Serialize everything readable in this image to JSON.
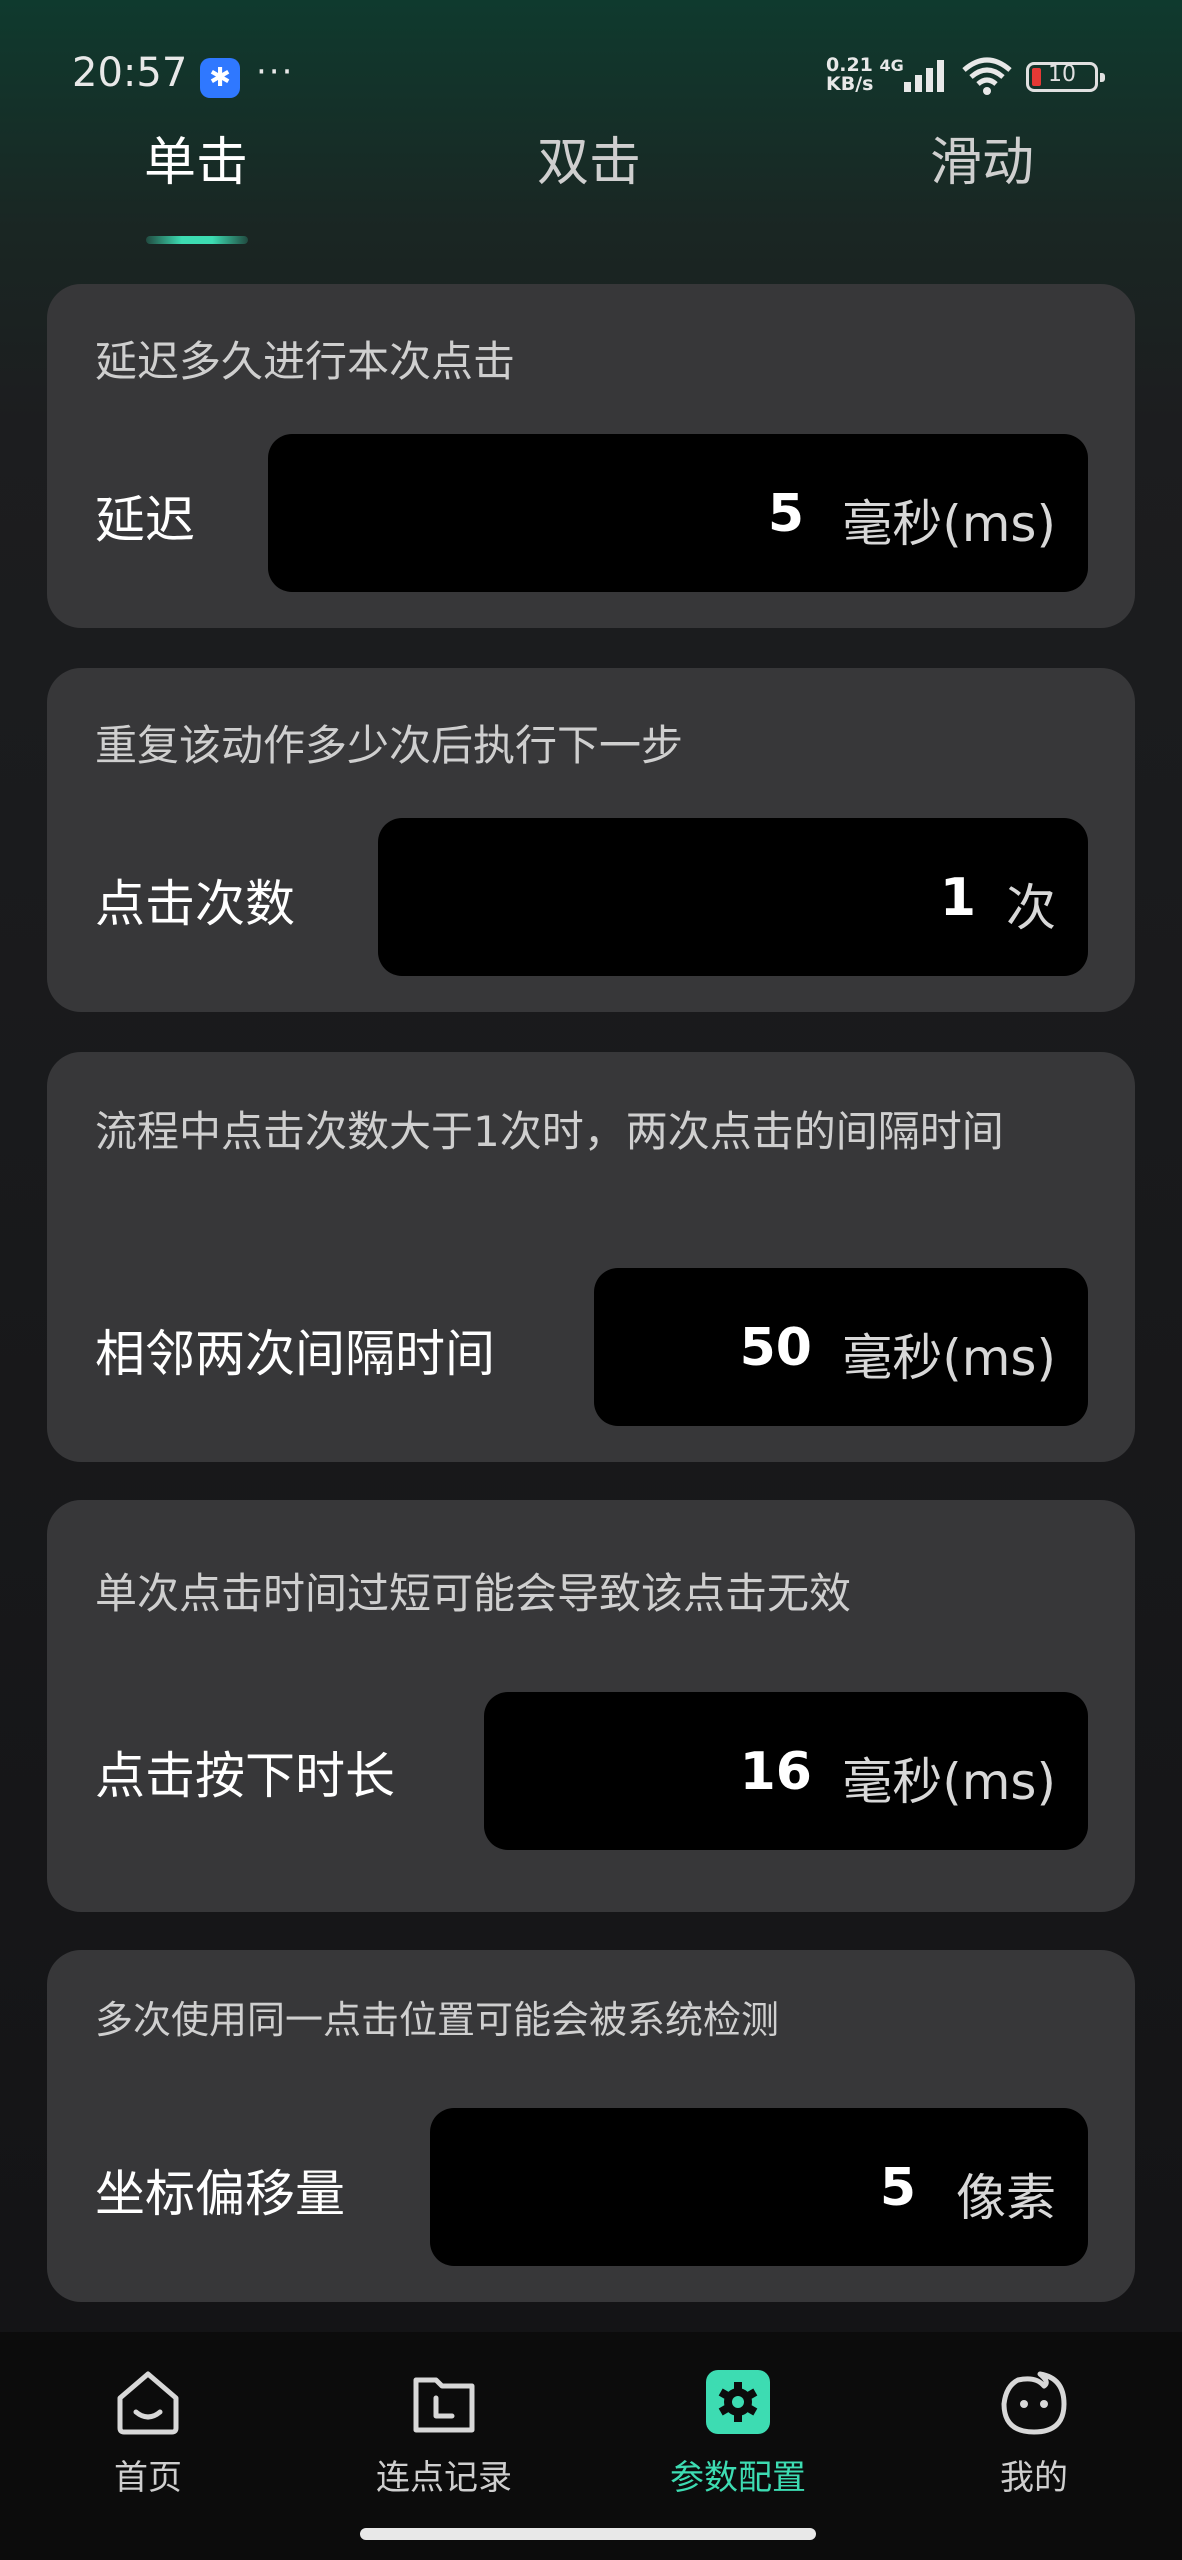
{
  "status": {
    "time": "20:57",
    "more": "···",
    "net_speed": "0.21",
    "net_unit": "KB/s",
    "net_gen": "4G",
    "battery": "10"
  },
  "tabs": [
    {
      "label": "单击",
      "active": true
    },
    {
      "label": "双击",
      "active": false
    },
    {
      "label": "滑动",
      "active": false
    }
  ],
  "cards": [
    {
      "desc": "延迟多久进行本次点击",
      "label": "延迟",
      "value": "5",
      "unit": "毫秒(ms)"
    },
    {
      "desc": "重复该动作多少次后执行下一步",
      "label": "点击次数",
      "value": "1",
      "unit": "次"
    },
    {
      "desc": "流程中点击次数大于1次时，两次点击的间隔时间",
      "label": "相邻两次间隔时间",
      "value": "50",
      "unit": "毫秒(ms)"
    },
    {
      "desc": "单次点击时间过短可能会导致该点击无效",
      "label": "点击按下时长",
      "value": "16",
      "unit": "毫秒(ms)"
    },
    {
      "desc": "多次使用同一点击位置可能会被系统检测",
      "label": "坐标偏移量",
      "value": "5",
      "unit": "像素"
    }
  ],
  "nav": [
    {
      "label": "首页",
      "icon": "home-icon"
    },
    {
      "label": "连点记录",
      "icon": "folder-clock-icon"
    },
    {
      "label": "参数配置",
      "icon": "gear-icon",
      "active": true
    },
    {
      "label": "我的",
      "icon": "profile-face-icon"
    }
  ],
  "colors": {
    "accent": "#3ddcb2",
    "card": "#373739",
    "field": "#000000"
  }
}
